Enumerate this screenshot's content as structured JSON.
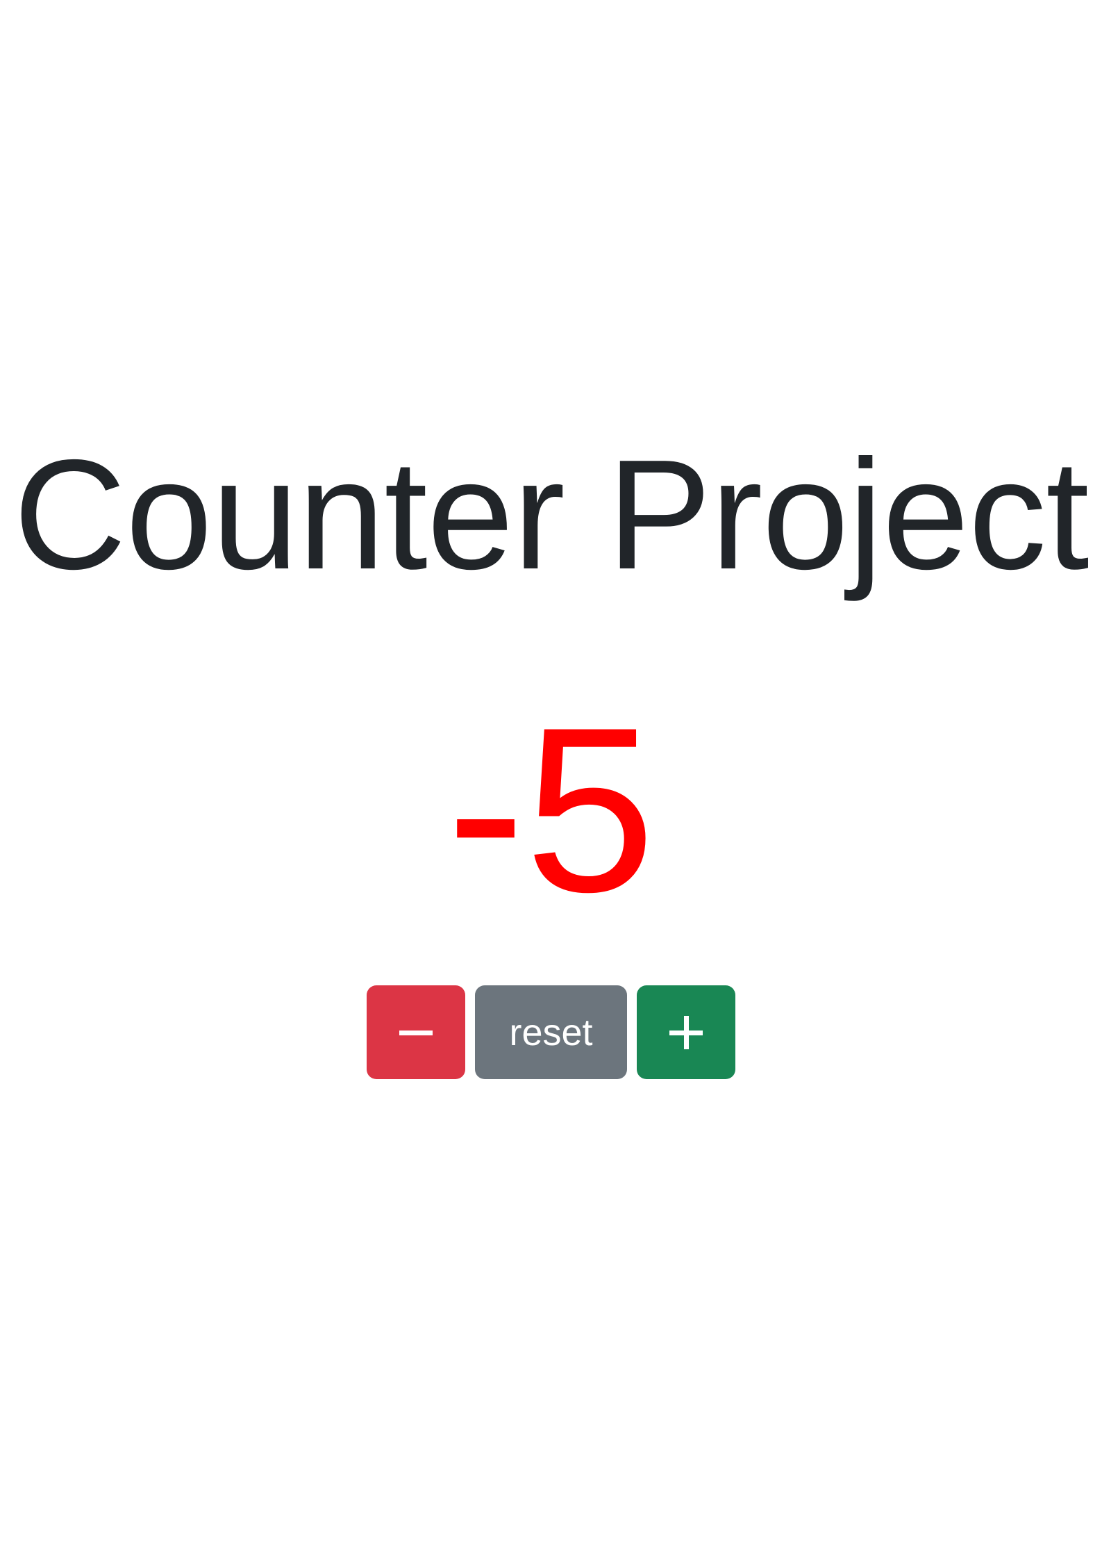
{
  "title": "Counter Project",
  "counter": {
    "value": "-5",
    "value_color": "#ff0000"
  },
  "buttons": {
    "decrement": {
      "icon": "minus-icon",
      "color": "#dc3545"
    },
    "reset": {
      "label": "reset",
      "color": "#6c757d"
    },
    "increment": {
      "icon": "plus-icon",
      "color": "#198754"
    }
  }
}
